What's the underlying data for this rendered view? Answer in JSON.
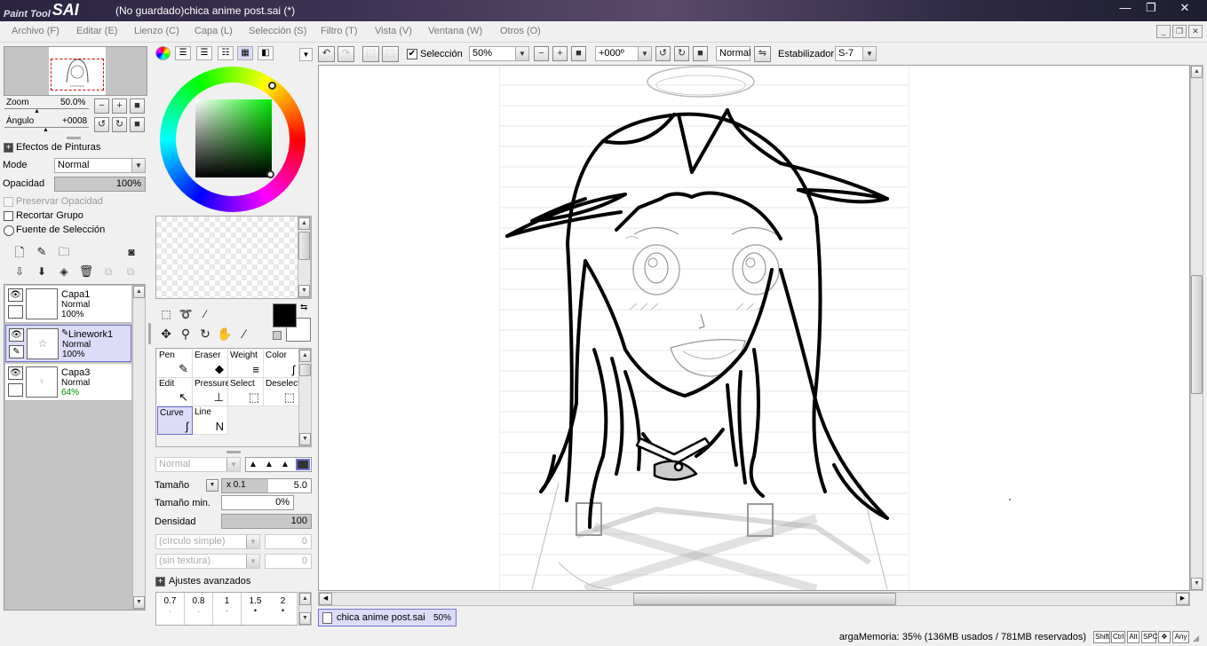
{
  "window": {
    "logo_small": "Paint Tool",
    "logo_big": "SAI",
    "title": "(No guardado)chica anime post.sai (*)",
    "min_glyph": "—",
    "max_glyph": "❐",
    "close_glyph": "✕"
  },
  "menu": [
    {
      "label": "Archivo (F)"
    },
    {
      "label": "Editar (E)"
    },
    {
      "label": "Lienzo (C)"
    },
    {
      "label": "Capa (L)"
    },
    {
      "label": "Selección (S)"
    },
    {
      "label": "Filtro (T)"
    },
    {
      "label": "Vista (V)"
    },
    {
      "label": "Ventana (W)"
    },
    {
      "label": "Otros (O)"
    }
  ],
  "navigator": {
    "zoom_label": "Zoom",
    "zoom_value": "50.0%",
    "angle_label": "Ángulo",
    "angle_value": "+0008"
  },
  "effects": {
    "header": "Efectos de Pinturas",
    "mode_label": "Mode",
    "mode_value": "Normal",
    "opacity_label": "Opacidad",
    "opacity_value": "100%",
    "opacity_level": 1.0,
    "preserve_opacity": "Preservar Opacidad",
    "clip_group": "Recortar Grupo",
    "selection_source": "Fuente de Selección"
  },
  "layers": [
    {
      "name": "Capa1",
      "mode": "Normal",
      "opacity": "100%",
      "selected": false
    },
    {
      "name": "Linework1",
      "mode": "Normal",
      "opacity": "100%",
      "selected": true
    },
    {
      "name": "Capa3",
      "mode": "Normal",
      "opacity": "64%",
      "selected": false
    }
  ],
  "brushes": [
    {
      "name": "Pen",
      "icon": "✎"
    },
    {
      "name": "Eraser",
      "icon": "◆"
    },
    {
      "name": "Weight",
      "icon": "≡"
    },
    {
      "name": "Color",
      "icon": "ʃ"
    },
    {
      "name": "Edit",
      "icon": "↖"
    },
    {
      "name": "Pressure",
      "icon": "⊥"
    },
    {
      "name": "Select",
      "icon": "⬚"
    },
    {
      "name": "Deselect",
      "icon": "⬚"
    },
    {
      "name": "Curve",
      "icon": "ʃ"
    },
    {
      "name": "Line",
      "icon": "N"
    }
  ],
  "brush_settings": {
    "blend_mode": "Normal",
    "size_label": "Tamaño",
    "size_multiplier": "x 0.1",
    "size_value": "5.0",
    "min_size_label": "Tamaño min.",
    "min_size_value": "0%",
    "density_label": "Densidad",
    "density_value": "100",
    "density_level": 1.0,
    "shape": "(círculo simple)",
    "shape_value": "0",
    "texture": "(sin textura)",
    "texture_value": "0",
    "advanced": "Ajustes avanzados",
    "preset_sizes": [
      "0.7",
      "0.8",
      "1",
      "1.5",
      "2"
    ]
  },
  "canvas_toolbar": {
    "selection_label": "Selección",
    "zoom_value": "50%",
    "angle_value": "+000º",
    "blend_value": "Normal",
    "stabilizer_label": "Estabilizador",
    "stabilizer_value": "S-7"
  },
  "document_tab": {
    "name": "chica anime post.sai",
    "zoom": "50%"
  },
  "status": {
    "memory": "argaMemoria: 35% (136MB usados / 781MB reservados)",
    "keys": [
      "Shift",
      "Ctrl",
      "Alt",
      "SPC",
      "✥",
      "Any"
    ]
  },
  "colors": {
    "primary": "#000000",
    "secondary": "#ffffff",
    "selection_accent": "#7070d0"
  }
}
